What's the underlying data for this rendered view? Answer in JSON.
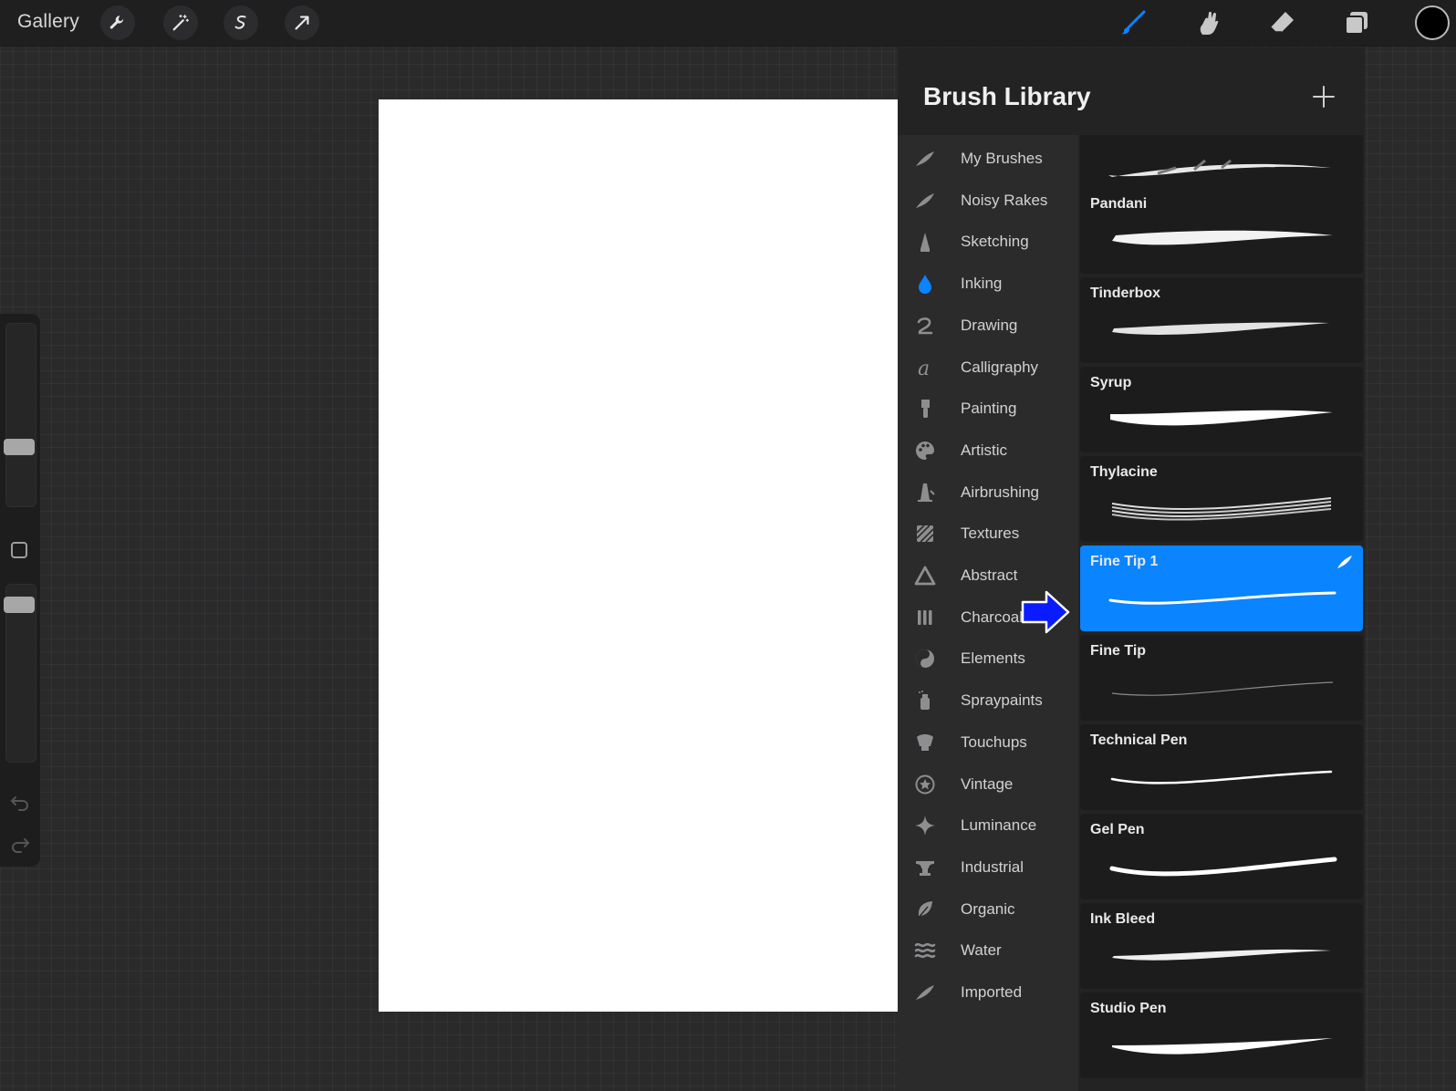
{
  "toolbar": {
    "gallery_label": "Gallery",
    "left_tools": [
      "wrench-icon",
      "magic-wand-icon",
      "selection-icon",
      "transform-arrow-icon"
    ],
    "right_tools": [
      "brush-icon",
      "smudge-icon",
      "eraser-icon",
      "layers-icon"
    ],
    "active_tool": "brush",
    "active_color": "#0a84ff",
    "current_color": "#000000"
  },
  "sidebar": {
    "size_slider_value": 0.3,
    "opacity_slider_value": 0.92
  },
  "brush_library": {
    "title": "Brush Library",
    "categories": [
      {
        "label": "My Brushes"
      },
      {
        "label": "Noisy Rakes"
      },
      {
        "label": "Sketching"
      },
      {
        "label": "Inking"
      },
      {
        "label": "Drawing"
      },
      {
        "label": "Calligraphy"
      },
      {
        "label": "Painting"
      },
      {
        "label": "Artistic"
      },
      {
        "label": "Airbrushing"
      },
      {
        "label": "Textures"
      },
      {
        "label": "Abstract"
      },
      {
        "label": "Charcoal"
      },
      {
        "label": "Elements"
      },
      {
        "label": "Spraypaints"
      },
      {
        "label": "Touchups"
      },
      {
        "label": "Vintage"
      },
      {
        "label": "Luminance"
      },
      {
        "label": "Industrial"
      },
      {
        "label": "Organic"
      },
      {
        "label": "Water"
      },
      {
        "label": "Imported"
      }
    ],
    "selected_category": "Inking",
    "brushes": [
      {
        "name": ""
      },
      {
        "name": "Pandani"
      },
      {
        "name": "Tinderbox"
      },
      {
        "name": "Syrup"
      },
      {
        "name": "Thylacine"
      },
      {
        "name": "Fine Tip 1"
      },
      {
        "name": "Fine Tip"
      },
      {
        "name": "Technical Pen"
      },
      {
        "name": "Gel Pen"
      },
      {
        "name": "Ink Bleed"
      },
      {
        "name": "Studio Pen"
      }
    ],
    "selected_brush": "Fine Tip 1"
  },
  "colors": {
    "accent": "#0a84ff",
    "panel": "#232324",
    "annotation_arrow": "#0a1cff"
  }
}
